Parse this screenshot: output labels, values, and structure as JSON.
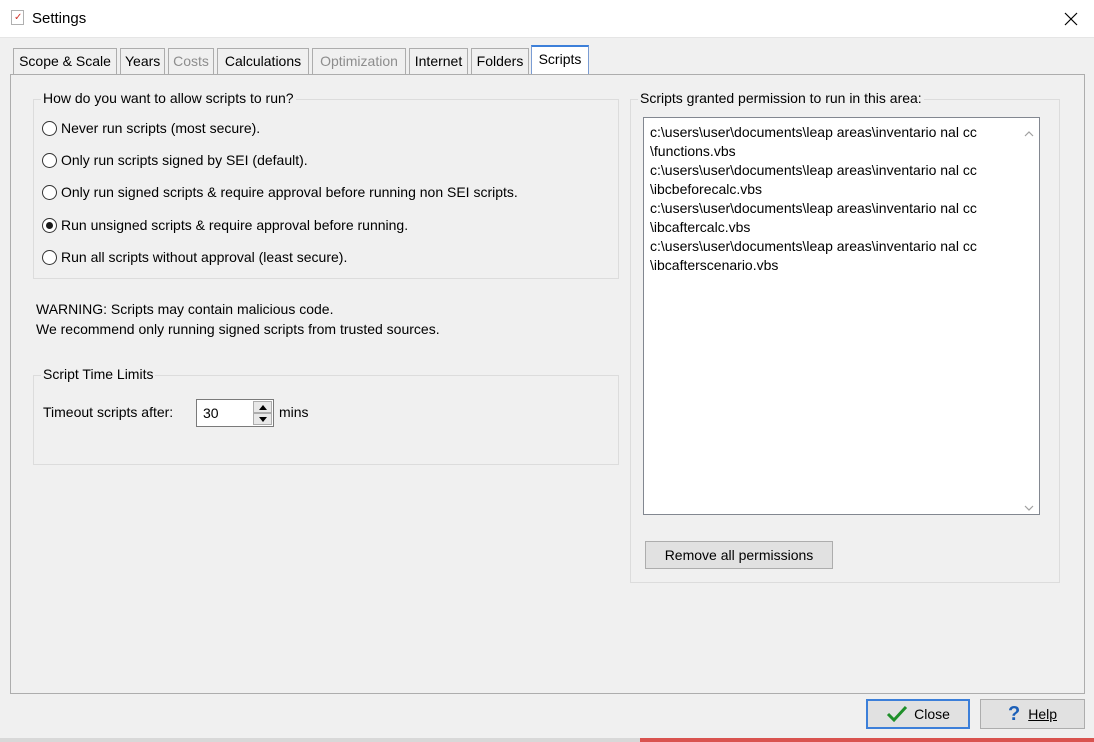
{
  "window": {
    "title": "Settings"
  },
  "tabs": [
    {
      "label": "Scope & Scale",
      "state": "normal"
    },
    {
      "label": "Years",
      "state": "normal"
    },
    {
      "label": "Costs",
      "state": "disabled"
    },
    {
      "label": "Calculations",
      "state": "normal"
    },
    {
      "label": "Optimization",
      "state": "disabled"
    },
    {
      "label": "Internet",
      "state": "normal"
    },
    {
      "label": "Folders",
      "state": "normal"
    },
    {
      "label": "Scripts",
      "state": "active"
    }
  ],
  "run_group": {
    "label": "How do you want to allow scripts to run?",
    "options": [
      {
        "label": "Never run scripts (most secure).",
        "checked": false
      },
      {
        "label": "Only run scripts signed by SEI (default).",
        "checked": false
      },
      {
        "label": "Only run signed scripts & require approval before running non SEI scripts.",
        "checked": false
      },
      {
        "label": "Run unsigned scripts & require approval before running.",
        "checked": true
      },
      {
        "label": "Run all scripts without approval (least secure).",
        "checked": false
      }
    ]
  },
  "warning": {
    "line1": "WARNING: Scripts may contain malicious code.",
    "line2": "We recommend only running signed scripts from trusted sources."
  },
  "time_limits": {
    "label": "Script Time Limits",
    "timeout_label": "Timeout scripts after:",
    "timeout_value": "30",
    "unit": "mins"
  },
  "permissions": {
    "label": "Scripts granted permission to run in this area:",
    "lines": [
      "c:\\users\\user\\documents\\leap areas\\inventario nal cc",
      "\\functions.vbs",
      "c:\\users\\user\\documents\\leap areas\\inventario nal cc",
      "\\ibcbeforecalc.vbs",
      "c:\\users\\user\\documents\\leap areas\\inventario nal cc",
      "\\ibcaftercalc.vbs",
      "c:\\users\\user\\documents\\leap areas\\inventario nal cc",
      "\\ibcafterscenario.vbs"
    ],
    "remove_button": "Remove all permissions"
  },
  "footer": {
    "close_label": "Close",
    "help_label": "Help"
  },
  "colors": {
    "accent": "#3c7fd9",
    "check_green": "#1f8f2a",
    "help_blue": "#1b5fb8"
  }
}
